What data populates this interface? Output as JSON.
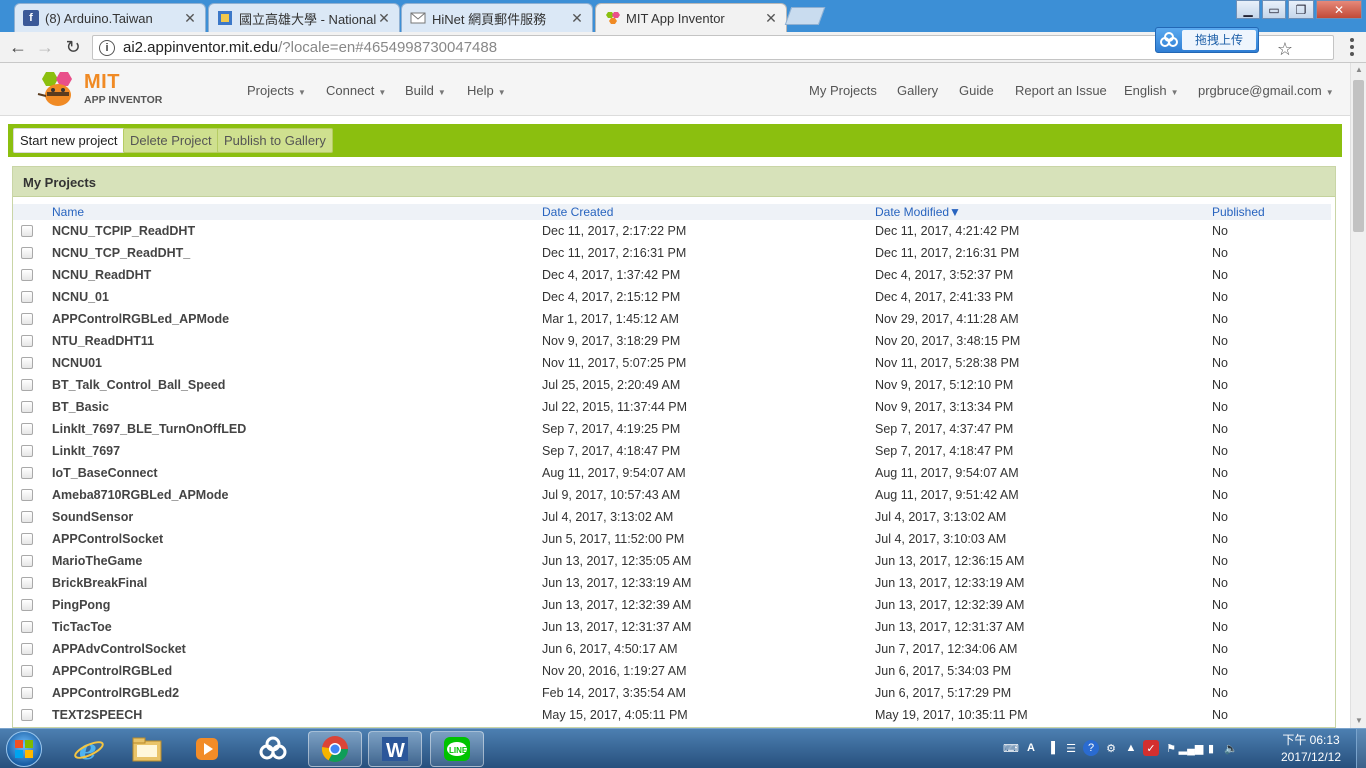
{
  "browser": {
    "tabs": [
      {
        "title": "(8) Arduino.Taiwan",
        "icon": "facebook-icon",
        "active": false
      },
      {
        "title": "國立高雄大學 - National",
        "icon": "nuk-icon",
        "active": false
      },
      {
        "title": "HiNet 網頁郵件服務",
        "icon": "mail-icon",
        "active": false
      },
      {
        "title": "MIT App Inventor",
        "icon": "appinventor-icon",
        "active": true
      }
    ],
    "url_host": "ai2.appinventor.mit.edu",
    "url_rest": "/?locale=en#4654998730047488",
    "extension_label": "拖拽上传"
  },
  "app": {
    "logo": {
      "line1": "MIT",
      "line2": "APP INVENTOR"
    },
    "left_menu": [
      "Projects",
      "Connect",
      "Build",
      "Help"
    ],
    "right_menu": {
      "my_projects": "My Projects",
      "gallery": "Gallery",
      "guide": "Guide",
      "report": "Report an Issue",
      "language": "English",
      "account": "prgbruce@gmail.com"
    },
    "actions": {
      "start": "Start new project",
      "delete": "Delete Project",
      "publish": "Publish to Gallery"
    },
    "panel_title": "My Projects",
    "columns": {
      "name": "Name",
      "created": "Date Created",
      "modified": "Date Modified",
      "sort_indicator": "▼",
      "published": "Published"
    },
    "projects": [
      {
        "name": "NCNU_TCPIP_ReadDHT",
        "created": "Dec 11, 2017, 2:17:22 PM",
        "modified": "Dec 11, 2017, 4:21:42 PM",
        "published": "No"
      },
      {
        "name": "NCNU_TCP_ReadDHT_",
        "created": "Dec 11, 2017, 2:16:31 PM",
        "modified": "Dec 11, 2017, 2:16:31 PM",
        "published": "No"
      },
      {
        "name": "NCNU_ReadDHT",
        "created": "Dec 4, 2017, 1:37:42 PM",
        "modified": "Dec 4, 2017, 3:52:37 PM",
        "published": "No"
      },
      {
        "name": "NCNU_01",
        "created": "Dec 4, 2017, 2:15:12 PM",
        "modified": "Dec 4, 2017, 2:41:33 PM",
        "published": "No"
      },
      {
        "name": "APPControlRGBLed_APMode",
        "created": "Mar 1, 2017, 1:45:12 AM",
        "modified": "Nov 29, 2017, 4:11:28 AM",
        "published": "No"
      },
      {
        "name": "NTU_ReadDHT11",
        "created": "Nov 9, 2017, 3:18:29 PM",
        "modified": "Nov 20, 2017, 3:48:15 PM",
        "published": "No"
      },
      {
        "name": "NCNU01",
        "created": "Nov 11, 2017, 5:07:25 PM",
        "modified": "Nov 11, 2017, 5:28:38 PM",
        "published": "No"
      },
      {
        "name": "BT_Talk_Control_Ball_Speed",
        "created": "Jul 25, 2015, 2:20:49 AM",
        "modified": "Nov 9, 2017, 5:12:10 PM",
        "published": "No"
      },
      {
        "name": "BT_Basic",
        "created": "Jul 22, 2015, 11:37:44 PM",
        "modified": "Nov 9, 2017, 3:13:34 PM",
        "published": "No"
      },
      {
        "name": "LinkIt_7697_BLE_TurnOnOffLED",
        "created": "Sep 7, 2017, 4:19:25 PM",
        "modified": "Sep 7, 2017, 4:37:47 PM",
        "published": "No"
      },
      {
        "name": "LinkIt_7697",
        "created": "Sep 7, 2017, 4:18:47 PM",
        "modified": "Sep 7, 2017, 4:18:47 PM",
        "published": "No"
      },
      {
        "name": "IoT_BaseConnect",
        "created": "Aug 11, 2017, 9:54:07 AM",
        "modified": "Aug 11, 2017, 9:54:07 AM",
        "published": "No"
      },
      {
        "name": "Ameba8710RGBLed_APMode",
        "created": "Jul 9, 2017, 10:57:43 AM",
        "modified": "Aug 11, 2017, 9:51:42 AM",
        "published": "No"
      },
      {
        "name": "SoundSensor",
        "created": "Jul 4, 2017, 3:13:02 AM",
        "modified": "Jul 4, 2017, 3:13:02 AM",
        "published": "No"
      },
      {
        "name": "APPControlSocket",
        "created": "Jun 5, 2017, 11:52:00 PM",
        "modified": "Jul 4, 2017, 3:10:03 AM",
        "published": "No"
      },
      {
        "name": "MarioTheGame",
        "created": "Jun 13, 2017, 12:35:05 AM",
        "modified": "Jun 13, 2017, 12:36:15 AM",
        "published": "No"
      },
      {
        "name": "BrickBreakFinal",
        "created": "Jun 13, 2017, 12:33:19 AM",
        "modified": "Jun 13, 2017, 12:33:19 AM",
        "published": "No"
      },
      {
        "name": "PingPong",
        "created": "Jun 13, 2017, 12:32:39 AM",
        "modified": "Jun 13, 2017, 12:32:39 AM",
        "published": "No"
      },
      {
        "name": "TicTacToe",
        "created": "Jun 13, 2017, 12:31:37 AM",
        "modified": "Jun 13, 2017, 12:31:37 AM",
        "published": "No"
      },
      {
        "name": "APPAdvControlSocket",
        "created": "Jun 6, 2017, 4:50:17 AM",
        "modified": "Jun 7, 2017, 12:34:06 AM",
        "published": "No"
      },
      {
        "name": "APPControlRGBLed",
        "created": "Nov 20, 2016, 1:19:27 AM",
        "modified": "Jun 6, 2017, 5:34:03 PM",
        "published": "No"
      },
      {
        "name": "APPControlRGBLed2",
        "created": "Feb 14, 2017, 3:35:54 AM",
        "modified": "Jun 6, 2017, 5:17:29 PM",
        "published": "No"
      },
      {
        "name": "TEXT2SPEECH",
        "created": "May 15, 2017, 4:05:11 PM",
        "modified": "May 19, 2017, 10:35:11 PM",
        "published": "No"
      }
    ]
  },
  "taskbar": {
    "clock_time": "下午 06:13",
    "clock_date": "2017/12/12",
    "apps": [
      "ie-icon",
      "file-explorer-icon",
      "media-player-icon",
      "cloud-sync-icon",
      "chrome-icon",
      "word-icon",
      "line-icon"
    ]
  },
  "colors": {
    "accent_green": "#8bbf0f",
    "link_blue": "#2864bf",
    "header_panel": "#d7e2ba"
  }
}
